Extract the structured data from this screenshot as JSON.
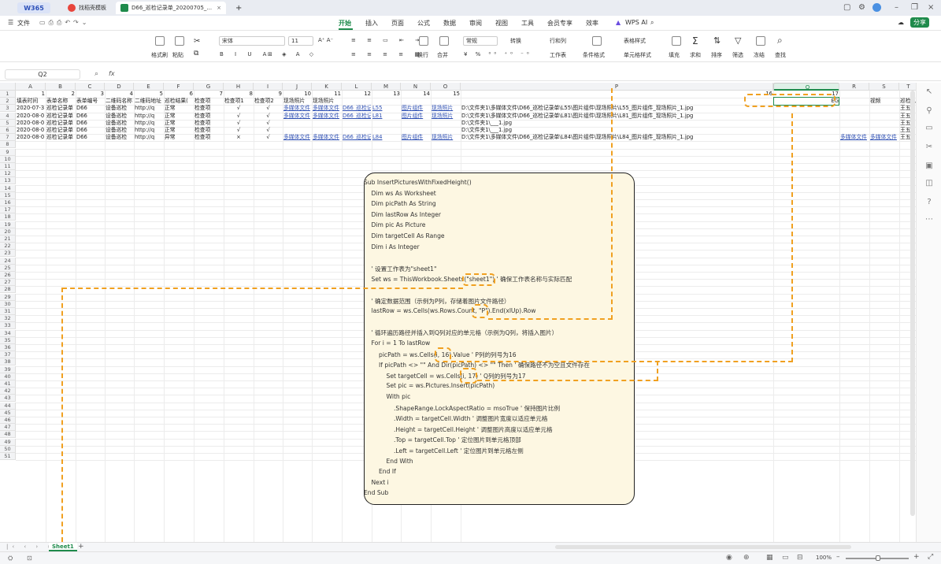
{
  "titlebar": {
    "logo": "W365",
    "tabs": [
      {
        "label": "找稻壳模板",
        "icon_color": "#e8453c"
      },
      {
        "label": "D66_巡检记录单_20200705_...",
        "icon_color": "#1f8b4c"
      }
    ],
    "add_tab": "+"
  },
  "menubar": {
    "file": "文件",
    "items": [
      "开始",
      "插入",
      "页面",
      "公式",
      "数据",
      "审阅",
      "视图",
      "工具",
      "会员专享",
      "效率",
      "WPS AI"
    ],
    "active": "开始",
    "share": "分享"
  },
  "ribbon": {
    "format_painter": "格式刷",
    "paste": "粘贴",
    "font_name": "宋体",
    "font_size": "11",
    "wrap": "换行",
    "merge": "合并",
    "number_format": "常规",
    "convert": "转换",
    "row_col": "行和列",
    "sheet": "工作表",
    "cond_format": "条件格式",
    "table_style": "表格样式",
    "cell_style": "单元格样式",
    "fill": "填充",
    "sum": "求和",
    "sort": "排序",
    "filter": "筛选",
    "freeze": "冻结",
    "find": "查找"
  },
  "formula_bar": {
    "cell_ref": "Q2",
    "fx": "fx",
    "content": ""
  },
  "grid": {
    "columns": [
      "A",
      "B",
      "C",
      "D",
      "E",
      "F",
      "G",
      "H",
      "I",
      "J",
      "K",
      "L",
      "M",
      "N",
      "O",
      "P",
      "Q",
      "R",
      "S",
      "T"
    ],
    "selected_column": "Q",
    "row_count": 51,
    "row1_numbers": [
      "1",
      "2",
      "3",
      "4",
      "5",
      "6",
      "7",
      "8",
      "9",
      "10",
      "11",
      "12",
      "13",
      "14",
      "15",
      "16",
      "17"
    ],
    "header_row": [
      "填表时间",
      "表单名称",
      "表单编号",
      "二维码名称",
      "二维码地址",
      "巡检结果(",
      "检查项",
      "检查项1",
      "检查项2",
      "现场照片",
      "现场照片",
      "",
      "",
      "",
      "",
      "",
      "",
      "",
      "视频",
      "巡检人"
    ],
    "q2_value": "EG",
    "rows": [
      [
        "2020-07-3",
        "巡检记录单",
        "D66",
        "设备巡检",
        "http://q",
        "正常",
        "检查项",
        "√",
        "√",
        "多媒体文件",
        "多媒体文件",
        "D66_巡检记",
        "L55",
        "图片组件",
        "现场照片",
        "D:\\文件夹1\\多媒体文件\\D66_巡检记录单\\L55\\图片组件\\现场照片\\L55_图片组件_现场照片_1.jpg",
        "",
        "",
        "",
        "王五"
      ],
      [
        "2020-08-0",
        "巡检记录单",
        "D66",
        "设备巡检",
        "http://q",
        "正常",
        "检查项",
        "√",
        "√",
        "多媒体文件",
        "多媒体文件",
        "D66_巡检记",
        "L81",
        "图片组件",
        "现场照片",
        "D:\\文件夹1\\多媒体文件\\D66_巡检记录单\\L81\\图片组件\\现场照片\\L81_图片组件_现场照片_1.jpg",
        "",
        "",
        "",
        "王五"
      ],
      [
        "2020-08-0",
        "巡检记录单",
        "D66",
        "设备巡检",
        "http://q",
        "正常",
        "检查项",
        "√",
        "√",
        "",
        "",
        "",
        "",
        "",
        "",
        "D:\\文件夹1\\___1.jpg",
        "",
        "",
        "",
        "王五"
      ],
      [
        "2020-08-0",
        "巡检记录单",
        "D66",
        "设备巡检",
        "http://q",
        "正常",
        "检查项",
        "√",
        "√",
        "",
        "",
        "",
        "",
        "",
        "",
        "D:\\文件夹1\\___1.jpg",
        "",
        "",
        "",
        "王五"
      ],
      [
        "2020-08-0",
        "巡检记录单",
        "D66",
        "设备巡检",
        "http://q",
        "异常",
        "检查项",
        "×",
        "√",
        "多媒体文件",
        "多媒体文件",
        "D66_巡检记",
        "L84",
        "图片组件",
        "现场照片",
        "D:\\文件夹1\\多媒体文件\\D66_巡检记录单\\L84\\图片组件\\现场照片\\L84_图片组件_现场照片_1.jpg",
        "",
        "多媒体文件",
        "多媒体文件",
        "王五"
      ]
    ]
  },
  "code": [
    "Sub InsertPicturesWithFixedHeight()",
    "Dim ws As Worksheet",
    "Dim picPath As String",
    "Dim lastRow As Integer",
    "Dim pic As Picture",
    "Dim targetCell As Range",
    "Dim i As Integer",
    "",
    "' 设置工作表为\"sheet1\"",
    "Set ws = ThisWorkbook.Sheets(\"sheet1\") ' 确保工作表名称与实际匹配",
    "",
    "' 确定数据范围（示例为P列，存储着图片文件路径）",
    "lastRow = ws.Cells(ws.Rows.Count, \"P\").End(xlUp).Row",
    "",
    "' 循环遍历路径并插入到Q列对应的单元格（示例为Q列，将插入图片）",
    "For i = 1 To lastRow",
    "picPath = ws.Cells(i, 16).Value ' P列的列号为16",
    "If picPath <> \"\" And Dir(picPath) <> \"\" Then ' 确保路径不为空且文件存在",
    "Set targetCell = ws.Cells(i, 17) ' Q列的列号为17",
    "Set pic = ws.Pictures.Insert(picPath)",
    "With pic",
    ".ShapeRange.LockAspectRatio = msoTrue ' 保持图片比例",
    ".Width = targetCell.Width ' 调整图片宽度以适应单元格",
    ".Height = targetCell.Height ' 调整图片高度以适应单元格",
    ".Top = targetCell.Top ' 定位图片到单元格顶部",
    ".Left = targetCell.Left ' 定位图片到单元格左侧",
    "End With",
    "End If",
    "Next i",
    "End Sub"
  ],
  "code_indent": [
    0,
    1,
    1,
    1,
    1,
    1,
    1,
    0,
    1,
    1,
    0,
    1,
    1,
    0,
    1,
    1,
    2,
    2,
    3,
    3,
    3,
    4,
    4,
    4,
    4,
    4,
    3,
    2,
    1,
    0
  ],
  "highlights": {
    "sheet_name": "\"sheet1\"",
    "col_p": "\"P\"",
    "col_16": "16",
    "col_17": "17"
  },
  "sheetbar": {
    "sheet_tab": "Sheet1",
    "add": "+"
  },
  "statusbar": {
    "zoom": "100%"
  },
  "colors": {
    "accent": "#1f8b4c",
    "highlight": "#f0a020",
    "code_bg": "#fdf7e2",
    "link": "#2e4fb3"
  }
}
